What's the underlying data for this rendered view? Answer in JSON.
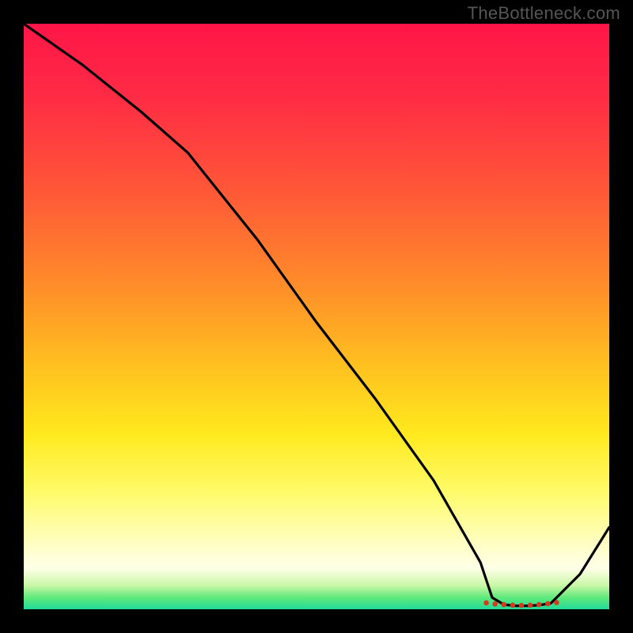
{
  "watermark": "TheBottleneck.com",
  "chart_data": {
    "type": "line",
    "title": "",
    "xlabel": "",
    "ylabel": "",
    "xlim": [
      0,
      100
    ],
    "ylim": [
      0,
      100
    ],
    "grid": false,
    "legend": false,
    "note": "Vertical gradient background encodes a color scale roughly: red (top, high values) → orange → yellow → pale yellow → green (bottom, low values). The black curve descends from top-left, with a slight knee, reaches a flat minimum near x≈80–90 marked with small red/orange dots, then rises toward bottom-right.",
    "series": [
      {
        "name": "curve",
        "x": [
          0,
          10,
          20,
          28,
          40,
          50,
          60,
          70,
          78,
          80,
          82,
          84,
          86,
          88,
          90,
          95,
          100
        ],
        "values": [
          100,
          93,
          85,
          78,
          63,
          49,
          36,
          22,
          8,
          2,
          0.8,
          0.6,
          0.6,
          0.7,
          1,
          6,
          14
        ]
      }
    ],
    "markers": {
      "name": "flat-minimum-dots",
      "color": "#d23b1f",
      "x": [
        79,
        80.5,
        82,
        83.5,
        85,
        86.5,
        88,
        89.5,
        91
      ],
      "values": [
        1.1,
        0.9,
        0.8,
        0.7,
        0.65,
        0.7,
        0.8,
        0.95,
        1.15
      ]
    }
  }
}
